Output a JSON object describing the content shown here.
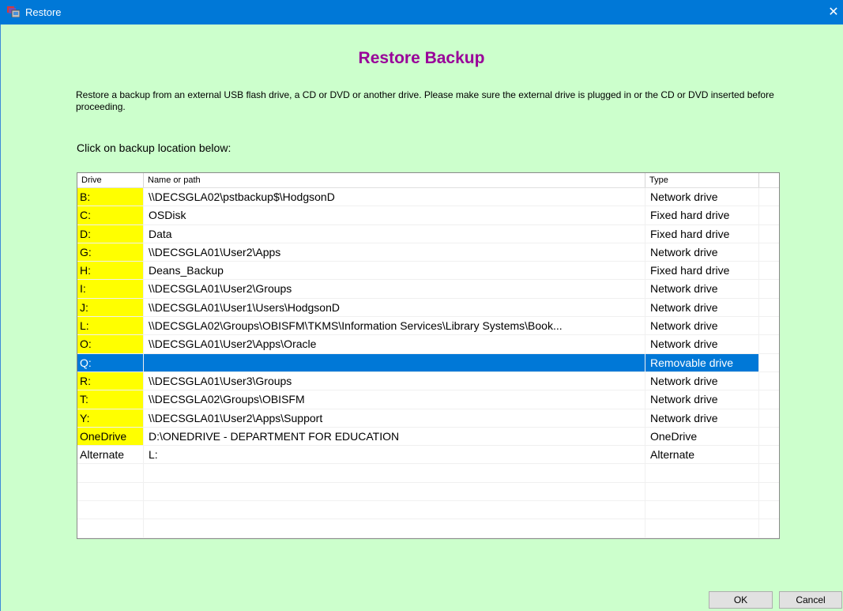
{
  "window": {
    "title": "Restore",
    "close_glyph": "✕",
    "icon": "restore-app-icon"
  },
  "heading": "Restore Backup",
  "description": "Restore a backup from an external USB flash drive, a CD or DVD or another drive.  Please make sure the external drive is plugged in or the CD or DVD inserted before proceeding.",
  "prompt": "Click on backup location below:",
  "list": {
    "columns": {
      "drive": "Drive",
      "name": "Name or path",
      "type": "Type"
    },
    "rows": [
      {
        "drive": "B:",
        "name": "\\\\DECSGLA02\\pstbackup$\\HodgsonD",
        "type": "Network drive",
        "highlight": true
      },
      {
        "drive": "C:",
        "name": "OSDisk",
        "type": "Fixed hard drive",
        "highlight": true
      },
      {
        "drive": "D:",
        "name": "Data",
        "type": "Fixed hard drive",
        "highlight": true
      },
      {
        "drive": "G:",
        "name": "\\\\DECSGLA01\\User2\\Apps",
        "type": "Network drive",
        "highlight": true
      },
      {
        "drive": "H:",
        "name": "Deans_Backup",
        "type": "Fixed hard drive",
        "highlight": true
      },
      {
        "drive": "I:",
        "name": "\\\\DECSGLA01\\User2\\Groups",
        "type": "Network drive",
        "highlight": true
      },
      {
        "drive": "J:",
        "name": "\\\\DECSGLA01\\User1\\Users\\HodgsonD",
        "type": "Network drive",
        "highlight": true
      },
      {
        "drive": "L:",
        "name": "\\\\DECSGLA02\\Groups\\OBISFM\\TKMS\\Information Services\\Library Systems\\Book...",
        "type": "Network drive",
        "highlight": true
      },
      {
        "drive": "O:",
        "name": "\\\\DECSGLA01\\User2\\Apps\\Oracle",
        "type": "Network drive",
        "highlight": true
      },
      {
        "drive": "Q:",
        "name": "",
        "type": "Removable drive",
        "highlight": true,
        "selected": true
      },
      {
        "drive": "R:",
        "name": "\\\\DECSGLA01\\User3\\Groups",
        "type": "Network drive",
        "highlight": true
      },
      {
        "drive": "T:",
        "name": "\\\\DECSGLA02\\Groups\\OBISFM",
        "type": "Network drive",
        "highlight": true
      },
      {
        "drive": "Y:",
        "name": "\\\\DECSGLA01\\User2\\Apps\\Support",
        "type": "Network drive",
        "highlight": true
      },
      {
        "drive": "OneDrive",
        "name": "D:\\ONEDRIVE - DEPARTMENT FOR EDUCATION",
        "type": "OneDrive",
        "highlight": true
      },
      {
        "drive": "Alternate",
        "name": "L:",
        "type": "Alternate",
        "highlight": false
      }
    ],
    "empty_rows": 4
  },
  "buttons": {
    "ok": "OK",
    "cancel": "Cancel"
  },
  "colors": {
    "background": "#ccffcc",
    "heading": "#990099",
    "highlight": "#ffff00",
    "selection": "#0078d7",
    "titlebar": "#0078d7"
  }
}
